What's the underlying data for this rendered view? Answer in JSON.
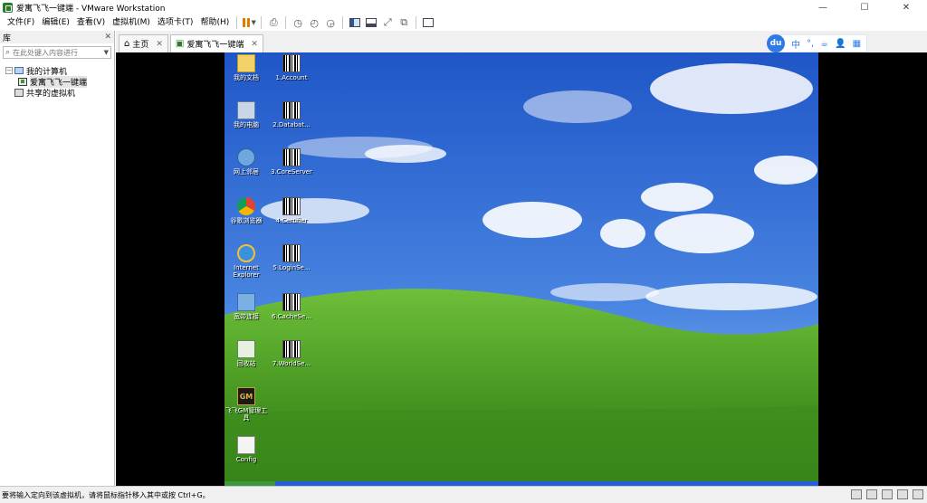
{
  "window": {
    "title": "爱寓飞飞一键端 - VMware Workstation",
    "minimize": "—",
    "maximize": "☐",
    "close": "✕"
  },
  "menu": {
    "items": [
      "文件(F)",
      "编辑(E)",
      "查看(V)",
      "虚拟机(M)",
      "选项卡(T)",
      "帮助(H)"
    ]
  },
  "toolbar": {
    "icons": [
      "pause-icon",
      "send-ctrl-alt-del-icon",
      "snapshot-icon",
      "revert-snapshot-icon",
      "snapshot-manager-icon",
      "show-library-icon",
      "thumbnail-bar-icon",
      "full-screen-icon",
      "unity-icon",
      "console-view-icon"
    ]
  },
  "library": {
    "title": "库",
    "search_placeholder": "在此处键入内容进行",
    "tree": [
      {
        "label": "我的计算机",
        "level": 0,
        "expanded": true
      },
      {
        "label": "爱寓飞飞一键端",
        "level": 1,
        "selected": true
      },
      {
        "label": "共享的虚拟机",
        "level": 0
      }
    ]
  },
  "tabs": [
    {
      "label": "主页",
      "icon": "home-icon",
      "active": false
    },
    {
      "label": "爱寓飞飞一键端",
      "icon": "vm-icon",
      "active": true
    }
  ],
  "ime": {
    "logo": "du",
    "items": [
      "中",
      "°,",
      "☕",
      "👤",
      "▦"
    ]
  },
  "desktop": {
    "icons_left": [
      {
        "label": "我的文档",
        "icon": "documents-icon"
      },
      {
        "label": "我的电脑",
        "icon": "computer-icon"
      },
      {
        "label": "网上邻居",
        "icon": "network-icon"
      },
      {
        "label": "谷歌浏览器",
        "icon": "chrome-icon"
      },
      {
        "label": "Internet Explorer",
        "icon": "ie-icon"
      },
      {
        "label": "宽带连接",
        "icon": "broadband-icon"
      },
      {
        "label": "回收站",
        "icon": "recycle-bin-icon"
      },
      {
        "label": "飞飞GM管理工具",
        "icon": "gm-icon"
      },
      {
        "label": "Config",
        "icon": "config-icon"
      }
    ],
    "icons_right": [
      {
        "label": "1.Account"
      },
      {
        "label": "2.Databat..."
      },
      {
        "label": "3.CoreServer"
      },
      {
        "label": "4.Certifier"
      },
      {
        "label": "5.LoginSe..."
      },
      {
        "label": "6.CacheSe..."
      },
      {
        "label": "7.WorldSe..."
      }
    ],
    "gm_text": "GM"
  },
  "status": {
    "message": "要将输入定向到该虚拟机，请将鼠标指针移入其中或按 Ctrl+G。"
  },
  "colors": {
    "accent": "#2e7be5",
    "pause": "#e07a00",
    "vm_background": "#000000",
    "sky": "#3d6fd1",
    "grass": "#4f9a2a"
  }
}
